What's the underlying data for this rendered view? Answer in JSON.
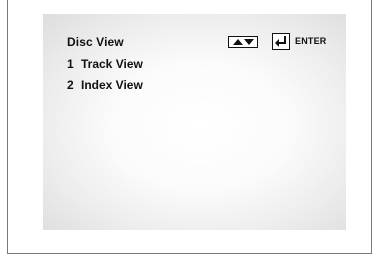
{
  "menu": {
    "title": "Disc View",
    "items": [
      {
        "number": "1",
        "label": "Track View"
      },
      {
        "number": "2",
        "label": "Index View"
      }
    ]
  },
  "controls": {
    "navigate_icon": "up-down-arrows-icon",
    "enter_icon": "enter-return-icon",
    "enter_label": "ENTER"
  },
  "colors": {
    "text": "#111111",
    "screen_center": "#ffffff",
    "screen_edge": "#dddddd",
    "frame_border": "#7a7a7a"
  }
}
